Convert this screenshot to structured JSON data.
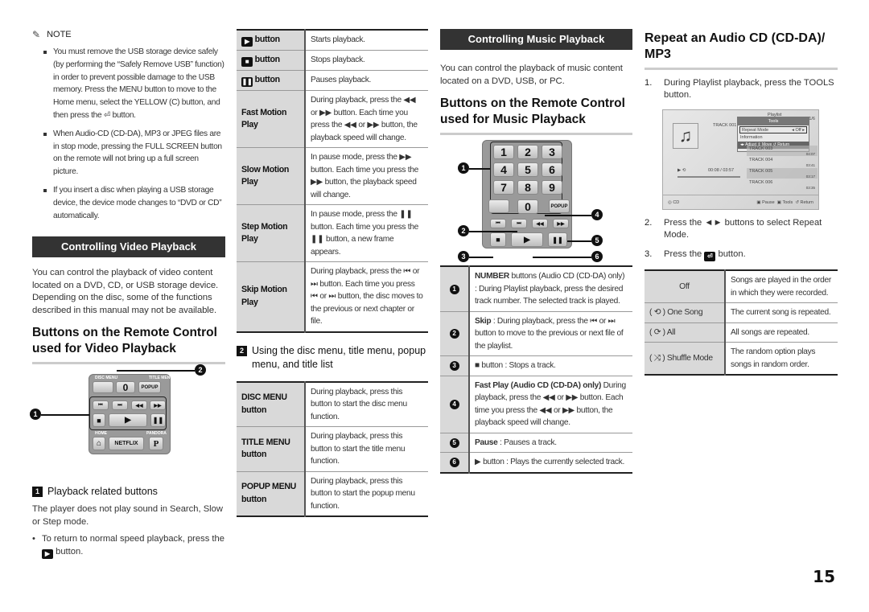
{
  "note": {
    "title": "NOTE",
    "items": [
      "You must remove the USB storage device safely (by performing the “Safely Remove USB” function) in order to prevent possible damage to the USB memory. Press the MENU button to move to the Home menu, select the YELLOW (C) button, and then press the ⏎ button.",
      "When Audio-CD (CD-DA), MP3 or JPEG files are in stop mode, pressing the FULL SCREEN button on the remote will not bring up a full screen picture.",
      "If you insert a disc when playing a USB storage device, the device mode changes to “DVD or CD” automatically."
    ]
  },
  "video": {
    "section_title": "Controlling Video Playback",
    "intro": "You can control the playback of video content located on a DVD, CD, or USB storage device. Depending on the disc, some of the functions described in this manual may not be available.",
    "heading": "Buttons on the Remote Control used for Video Playback",
    "remote": {
      "disc_menu": "DISC MENU",
      "title_menu": "TITLE MENU",
      "zero": "0",
      "popup": "POPUP",
      "home": "HOME",
      "pandora": "PANDORA",
      "netflix": "NETFLIX",
      "p": "P",
      "callout_1": "1",
      "callout_2": "2"
    },
    "sub1": {
      "num": "1",
      "title": "Playback related buttons"
    },
    "sub1_text": "The player does not play sound in Search, Slow or Step mode.",
    "sub1_bullet_a": "To return to normal speed playback, press the",
    "sub1_bullet_b": "button.",
    "table": [
      {
        "key": "button",
        "icon": "play",
        "value": "Starts playback."
      },
      {
        "key": "button",
        "icon": "stop",
        "value": "Stops playback."
      },
      {
        "key": "button",
        "icon": "pause",
        "value": "Pauses playback."
      },
      {
        "key": "Fast Motion Play",
        "value": "During playback, press the ◀◀ or ▶▶ button. Each time you press the ◀◀ or ▶▶ button, the playback speed will change."
      },
      {
        "key": "Slow Motion Play",
        "value": "In pause mode, press the ▶▶ button. Each time you press the ▶▶ button, the playback speed will change."
      },
      {
        "key": "Step Motion Play",
        "value": "In pause mode, press the ❚❚ button. Each time you press the ❚❚ button, a new frame appears."
      },
      {
        "key": "Skip Motion Play",
        "value": "During playback, press the ⏮ or ⏭ button. Each time you press ⏮ or ⏭ button, the disc moves to the previous or next chapter or file."
      }
    ],
    "sub2": {
      "num": "2",
      "title": "Using the disc menu, title menu, popup menu, and title list"
    },
    "menu_table": [
      {
        "key": "DISC MENU button",
        "value": "During playback, press this button to start the disc menu function."
      },
      {
        "key": "TITLE MENU button",
        "value": "During playback, press this button to start the title menu function."
      },
      {
        "key": "POPUP MENU button",
        "value": "During playback, press this button to start the popup menu function."
      }
    ]
  },
  "music": {
    "section_title": "Controlling Music Playback",
    "intro": "You can control the playback of music content located on a DVD, USB, or PC.",
    "heading": "Buttons on the Remote Control used for Music Playback",
    "keys": [
      "1",
      "2",
      "3",
      "4",
      "5",
      "6",
      "7",
      "8",
      "9",
      "0"
    ],
    "popup": "POPUP",
    "callouts": [
      "1",
      "2",
      "3",
      "4",
      "5",
      "6"
    ],
    "table": [
      {
        "n": "1",
        "bold": "NUMBER",
        "text": " buttons (Audio CD (CD-DA) only) : During Playlist playback, press the desired track number. The selected track is played."
      },
      {
        "n": "2",
        "bold": "Skip",
        "text": " : During playback, press the ⏮ or ⏭ button to move to the previous or next file of the playlist."
      },
      {
        "n": "3",
        "bold": "",
        "text": "■ button : Stops a track."
      },
      {
        "n": "4",
        "bold": "Fast Play (Audio CD (CD-DA) only)",
        "text": " During playback, press the ◀◀ or ▶▶ button. Each time you press the ◀◀ or ▶▶ button, the playback speed will change."
      },
      {
        "n": "5",
        "bold": "Pause",
        "text": " : Pauses a track."
      },
      {
        "n": "6",
        "bold": "",
        "text": "▶ button : Plays the currently selected track."
      }
    ]
  },
  "repeat": {
    "heading": "Repeat an Audio CD (CD-DA)/ MP3",
    "step1_num": "1.",
    "step1": "During Playlist playback, press the TOOLS button.",
    "screen": {
      "playlist": "Playlist",
      "count": "1/6",
      "track_current": "TRACK 001",
      "tools_title": "Tools",
      "repeat_mode": "Repeat Mode",
      "repeat_value": "Off",
      "information": "Information",
      "hint": "◂▸ Adjust  ⇕ Move  ↺ Return",
      "tracks": [
        {
          "name": "TRACK 003",
          "time": "04:07"
        },
        {
          "name": "TRACK 004",
          "time": "03:41"
        },
        {
          "name": "TRACK 005",
          "time": "03:17"
        },
        {
          "name": "TRACK 006",
          "time": "03:35"
        }
      ],
      "elapsed": "00:08 / 03:57",
      "source": "CD",
      "pause": "Pause",
      "tools": "Tools",
      "return": "Return"
    },
    "step2_num": "2.",
    "step2": "Press the ◄► buttons to select Repeat Mode.",
    "step3_num": "3.",
    "step3_a": "Press the",
    "step3_b": "button.",
    "table": [
      {
        "key": "Off",
        "value": "Songs are played in the order in which they were recorded."
      },
      {
        "key": "( ⟲ ) One Song",
        "value": "The current song is repeated."
      },
      {
        "key": "( ⟳ ) All",
        "value": "All songs are repeated."
      },
      {
        "key": "( ⤨ ) Shuffle Mode",
        "value": "The random option plays songs in random order."
      }
    ]
  },
  "page_number": "15"
}
